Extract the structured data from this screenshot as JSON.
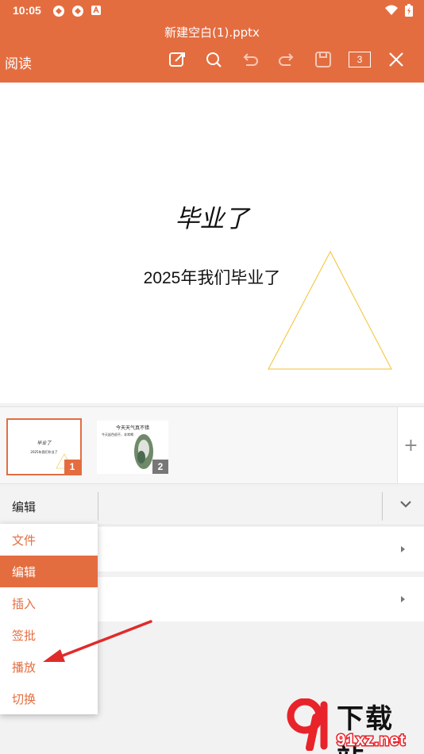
{
  "status": {
    "time": "10:05"
  },
  "header": {
    "doc_title": "新建空白(1).pptx",
    "read_label": "阅读",
    "page_count": "3"
  },
  "slide": {
    "title": "毕业了",
    "subtitle": "2025年我们毕业了",
    "shape_color": "#f2c230"
  },
  "thumbnails": [
    {
      "number": "1",
      "title": "毕业了",
      "subtitle": "2025年我们毕业了"
    },
    {
      "number": "2",
      "title": "今天天气真不错",
      "bullet": "今天起色很不，非常喝"
    }
  ],
  "panel": {
    "current_tab": "编辑"
  },
  "menu": {
    "items": [
      {
        "label": "文件"
      },
      {
        "label": "编辑"
      },
      {
        "label": "插入"
      },
      {
        "label": "签批"
      },
      {
        "label": "播放"
      },
      {
        "label": "切换"
      }
    ],
    "active_index": 1
  },
  "watermark": {
    "text_cn": "下载站",
    "text_url": "91xz.net"
  },
  "colors": {
    "accent": "#e46d40",
    "annotation": "#e02b2b"
  }
}
